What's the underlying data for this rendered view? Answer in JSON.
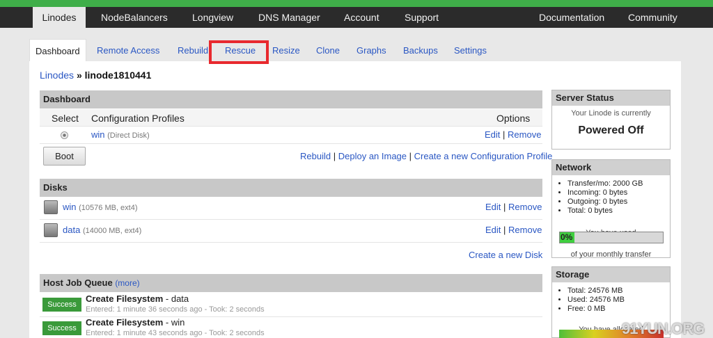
{
  "top_nav": {
    "left": [
      "Linodes",
      "NodeBalancers",
      "Longview",
      "DNS Manager",
      "Account",
      "Support"
    ],
    "right": [
      "Documentation",
      "Community"
    ]
  },
  "sub_tabs": [
    "Dashboard",
    "Remote Access",
    "Rebuild",
    "Rescue",
    "Resize",
    "Clone",
    "Graphs",
    "Backups",
    "Settings"
  ],
  "breadcrumb": {
    "root": "Linodes",
    "sep": "»",
    "current": "linode1810441"
  },
  "dashboard": {
    "title": "Dashboard",
    "col_select": "Select",
    "col_profiles": "Configuration Profiles",
    "col_options": "Options",
    "profile": {
      "name": "win",
      "note": "(Direct Disk)",
      "edit": "Edit",
      "sep": "|",
      "remove": "Remove"
    },
    "boot": "Boot",
    "actions": {
      "rebuild": "Rebuild",
      "deploy": "Deploy an Image",
      "create": "Create a new Configuration Profile",
      "sep": "|"
    }
  },
  "disks": {
    "title": "Disks",
    "items": [
      {
        "name": "win",
        "meta": "(10576 MB, ext4)",
        "edit": "Edit",
        "remove": "Remove"
      },
      {
        "name": "data",
        "meta": "(14000 MB, ext4)",
        "edit": "Edit",
        "remove": "Remove"
      }
    ],
    "sep": "|",
    "create": "Create a new Disk"
  },
  "jobs": {
    "title": "Host Job Queue",
    "more": "(more)",
    "items": [
      {
        "status": "Success",
        "title": "Create Filesystem",
        "suffix": " - data",
        "sub": "Entered: 1 minute 36 seconds ago - Took: 2 seconds"
      },
      {
        "status": "Success",
        "title": "Create Filesystem",
        "suffix": " - win",
        "sub": "Entered: 1 minute 43 seconds ago - Took: 2 seconds"
      }
    ]
  },
  "server_status": {
    "title": "Server Status",
    "line": "Your Linode is currently",
    "state": "Powered Off"
  },
  "network": {
    "title": "Network",
    "items": [
      "Transfer/mo: 2000 GB",
      "Incoming: 0 bytes",
      "Outgoing: 0 bytes",
      "Total: 0 bytes"
    ],
    "used_label": "You have used",
    "percent": "0%",
    "percent_value": 0,
    "transfer_label": "of your monthly transfer"
  },
  "storage": {
    "title": "Storage",
    "items": [
      "Total: 24576 MB",
      "Used: 24576 MB",
      "Free: 0 MB"
    ],
    "allocated_label": "You have allocated"
  },
  "watermark": "91YUN.ORG",
  "colors": {
    "accent_green": "#3fae49",
    "link": "#2a57c3",
    "highlight": "#e8292e",
    "success": "#3a9a3a"
  }
}
